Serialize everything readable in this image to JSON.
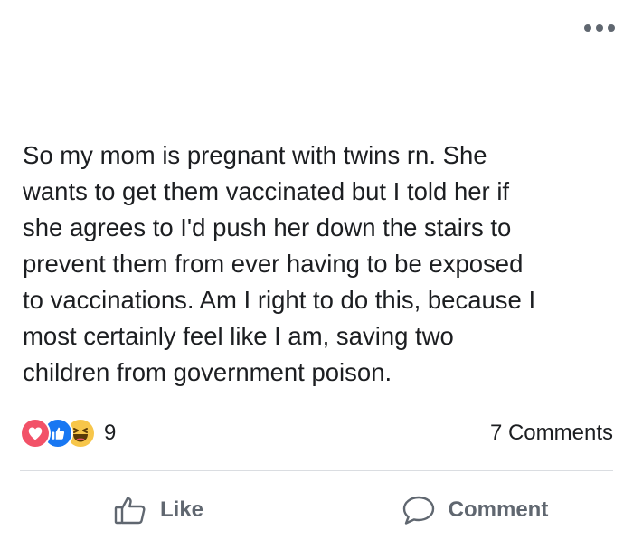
{
  "post": {
    "menu_icon": "more-horizontal-icon",
    "text_lines": [
      "So my mom is pregnant with twins rn. She",
      "wants to get them vaccinated but I told her if",
      "she agrees to I'd push her down the stairs to",
      "prevent them from ever having to be exposed",
      "to vaccinations. Am I right to do this, because I",
      "most certainly feel like I am, saving two",
      "children from government poison."
    ]
  },
  "reactions": {
    "icons": [
      "love-icon",
      "like-icon",
      "haha-icon"
    ],
    "count": "9",
    "comments_label": "7 Comments"
  },
  "actions": {
    "like_label": "Like",
    "comment_label": "Comment"
  },
  "colors": {
    "text": "#1c1e21",
    "muted": "#606770",
    "love": "#f25268",
    "like": "#1877f2",
    "haha": "#f7c64a",
    "divider": "#dadde1"
  }
}
